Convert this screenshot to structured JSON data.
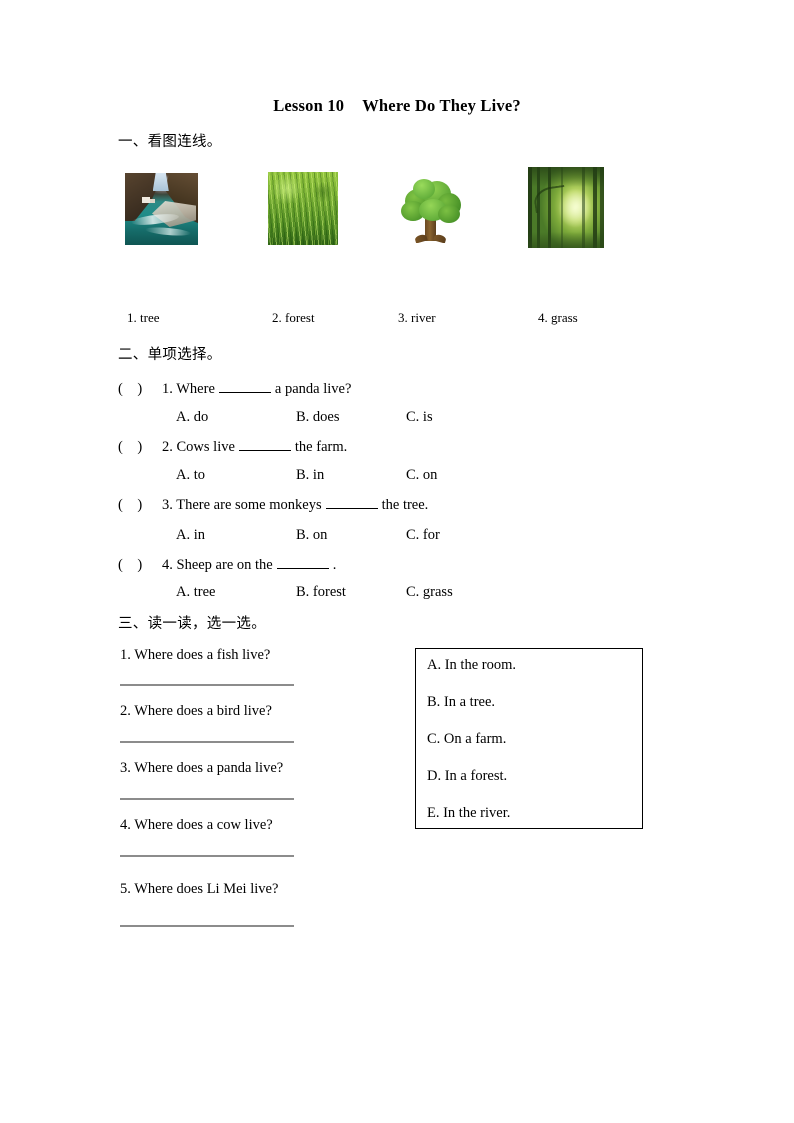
{
  "title": {
    "lesson": "Lesson 10",
    "name": "Where Do They Live?"
  },
  "section1": {
    "header": "一、看图连线。",
    "pictures": [
      {
        "icon": "river-photo-icon",
        "alt": "river"
      },
      {
        "icon": "grass-photo-icon",
        "alt": "grass"
      },
      {
        "icon": "tree-illustration-icon",
        "alt": "tree"
      },
      {
        "icon": "forest-photo-icon",
        "alt": "forest"
      }
    ],
    "labels": [
      "1. tree",
      "2. forest",
      "3. river",
      "4. grass"
    ]
  },
  "section2": {
    "header": "二、单项选择。",
    "questions": [
      {
        "number": "1.",
        "prompt_before": "Where",
        "prompt_after": "a panda live?",
        "options": [
          "A. do",
          "B. does",
          "C. is"
        ]
      },
      {
        "number": "2.",
        "prompt_before": "Cows live",
        "prompt_after": "the farm.",
        "options": [
          "A. to",
          "B. in",
          "C. on"
        ]
      },
      {
        "number": "3.",
        "prompt_before": "There are some monkeys",
        "prompt_after": "the tree.",
        "options": [
          "A. in",
          "B. on",
          "C. for"
        ]
      },
      {
        "number": "4.",
        "prompt_before": "Sheep are on the",
        "prompt_after": ".",
        "options": [
          "A. tree",
          "B. forest",
          "C. grass"
        ]
      }
    ]
  },
  "section3": {
    "header": "三、读一读，选一选。",
    "questions": [
      "1. Where does a fish live?",
      "2. Where does a bird live?",
      "3. Where does a panda live?",
      "4. Where does a cow live?",
      "5. Where does Li Mei live?"
    ],
    "choices": [
      "A. In the room.",
      "B. In a tree.",
      "C. On a farm.",
      "D. In a forest.",
      "E. In the river."
    ]
  },
  "colors": {
    "text": "#000000",
    "answer_line": "#8c8c8c",
    "box_border": "#000000",
    "page_background": "#ffffff"
  }
}
